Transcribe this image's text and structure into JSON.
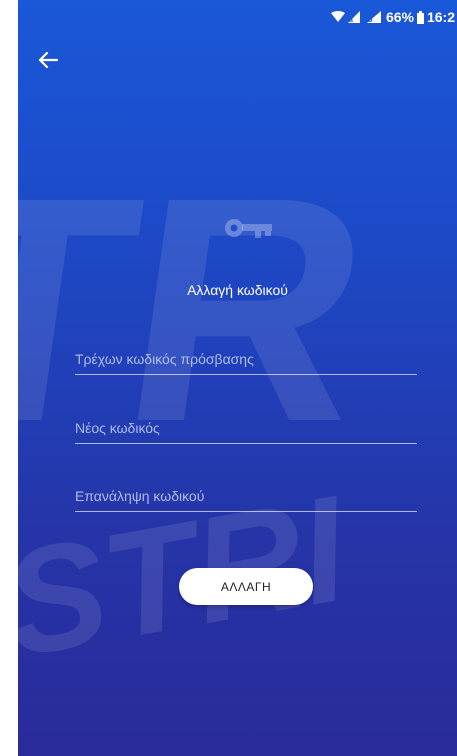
{
  "status_bar": {
    "battery_percent": "66%",
    "time": "16:2"
  },
  "screen": {
    "title": "Αλλαγή κωδικού",
    "fields": [
      {
        "placeholder": "Τρέχων κωδικός πρόσβασης",
        "value": ""
      },
      {
        "placeholder": "Νέος κωδικός",
        "value": ""
      },
      {
        "placeholder": "Επανάληψη κωδικού",
        "value": ""
      }
    ],
    "submit_label": "ΑΛΛΑΓΗ"
  },
  "watermark": {
    "text_large": "TR",
    "text_small": "ISTRI"
  },
  "colors": {
    "gradient_top": "#1958d8",
    "gradient_bottom": "#2a2a9a",
    "text": "#ffffff",
    "button_bg": "#ffffff"
  }
}
